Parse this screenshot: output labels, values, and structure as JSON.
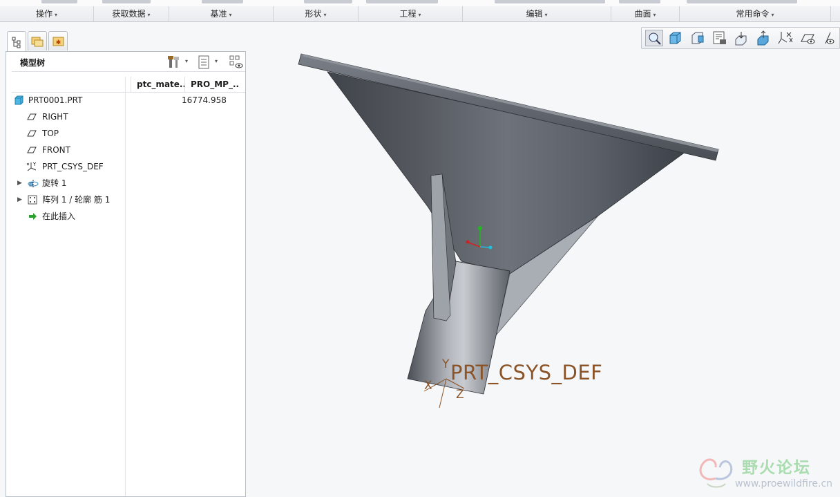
{
  "ribbon": {
    "groups": [
      {
        "label": "操作"
      },
      {
        "label": "获取数据"
      },
      {
        "label": "基准"
      },
      {
        "label": "形状"
      },
      {
        "label": "工程"
      },
      {
        "label": "编辑"
      },
      {
        "label": "曲面"
      },
      {
        "label": "常用命令"
      }
    ],
    "caret": "▾"
  },
  "navigator": {
    "tabs": [
      "model-tree-tab",
      "folder-browser-tab",
      "favorites-tab"
    ]
  },
  "model_tree": {
    "title": "模型树",
    "columns": [
      "ptc_mate...",
      "PRO_MP_..."
    ],
    "items": [
      {
        "label": "PRT0001.PRT",
        "icon": "part-icon",
        "value": "16774.958"
      },
      {
        "label": "RIGHT",
        "icon": "datum-plane-icon"
      },
      {
        "label": "TOP",
        "icon": "datum-plane-icon"
      },
      {
        "label": "FRONT",
        "icon": "datum-plane-icon"
      },
      {
        "label": "PRT_CSYS_DEF",
        "icon": "csys-icon"
      },
      {
        "label": "旋转 1",
        "icon": "revolve-icon",
        "expander": "▶"
      },
      {
        "label": "阵列 1 / 轮廓 筋 1",
        "icon": "pattern-icon",
        "expander": "▶"
      },
      {
        "label": "在此插入",
        "icon": "insert-here-arrow-icon"
      }
    ]
  },
  "viewport": {
    "csys_label": "PRT_CSYS_DEF",
    "axes": {
      "x": "X",
      "y": "Y",
      "z": "Z"
    }
  },
  "watermark": {
    "brand": "野火论坛",
    "url": "www.proewildfire.cn"
  },
  "colors": {
    "part_dark": "#3f434a",
    "part_mid": "#6b7079",
    "part_light": "#a7abb2",
    "csys_text": "#8a5428",
    "axis_green": "#1fb81f",
    "axis_red": "#d42020",
    "axis_cyan": "#19c2dc"
  }
}
